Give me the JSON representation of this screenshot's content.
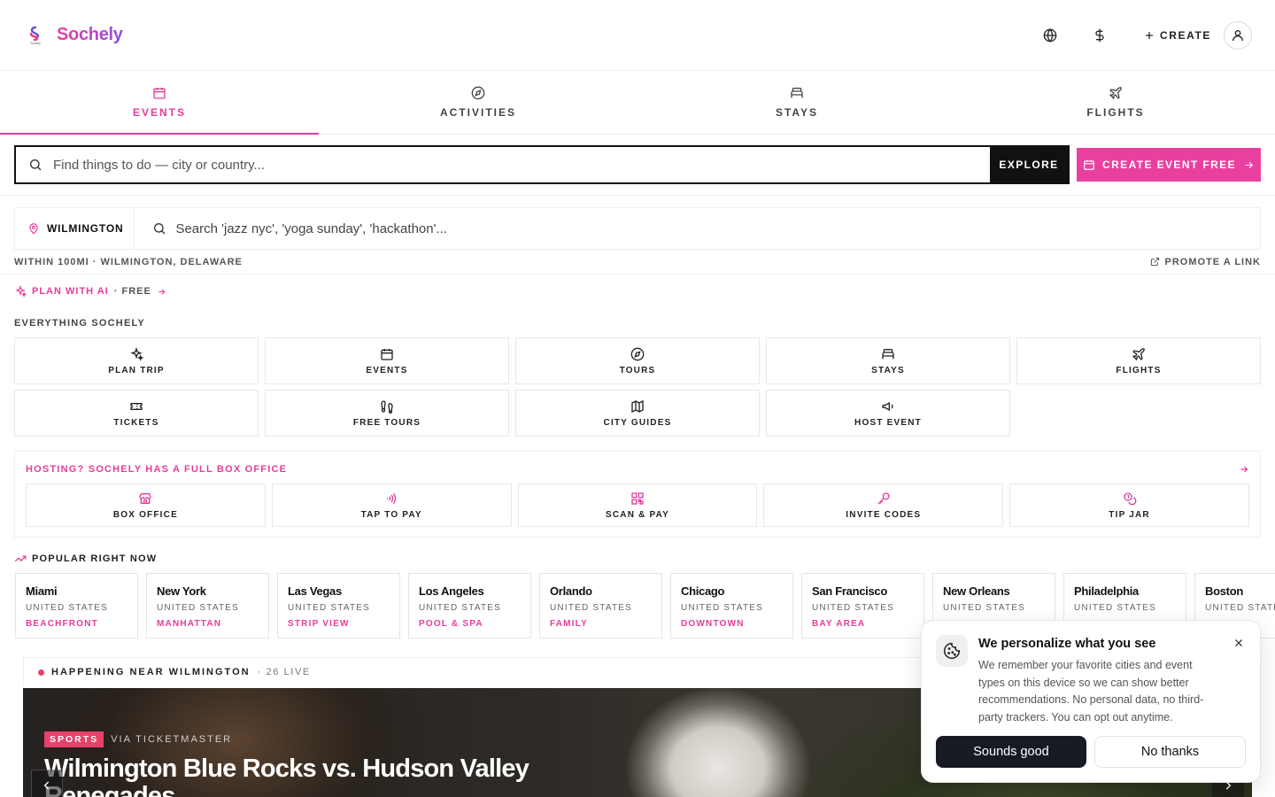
{
  "brand": {
    "name": "Sochely",
    "logo_caption": "Sochely"
  },
  "header": {
    "create_label": "CREATE"
  },
  "tabs": [
    {
      "label": "EVENTS",
      "icon": "calendar-icon",
      "active": true
    },
    {
      "label": "ACTIVITIES",
      "icon": "compass-icon",
      "active": false
    },
    {
      "label": "STAYS",
      "icon": "bed-icon",
      "active": false
    },
    {
      "label": "FLIGHTS",
      "icon": "plane-icon",
      "active": false
    }
  ],
  "search": {
    "placeholder": "Find things to do — city or country...",
    "explore_label": "EXPLORE",
    "create_event_label": "CREATE EVENT FREE"
  },
  "city_bar": {
    "city": "WILMINGTON",
    "placeholder": "Search 'jazz nyc', 'yoga sunday', 'hackathon'...",
    "radius_text": "WITHIN 100MI · WILMINGTON, DELAWARE",
    "promote_label": "PROMOTE A LINK"
  },
  "ai": {
    "label": "PLAN WITH AI",
    "free": "· FREE"
  },
  "everything": {
    "heading": "EVERYTHING SOCHELY",
    "items": [
      {
        "label": "PLAN TRIP",
        "icon": "sparkle-icon"
      },
      {
        "label": "EVENTS",
        "icon": "calendar-icon"
      },
      {
        "label": "TOURS",
        "icon": "compass-icon"
      },
      {
        "label": "STAYS",
        "icon": "bed-icon"
      },
      {
        "label": "FLIGHTS",
        "icon": "plane-icon"
      },
      {
        "label": "TICKETS",
        "icon": "ticket-icon"
      },
      {
        "label": "FREE TOURS",
        "icon": "footprints-icon"
      },
      {
        "label": "CITY GUIDES",
        "icon": "map-icon"
      },
      {
        "label": "HOST EVENT",
        "icon": "megaphone-icon"
      }
    ]
  },
  "hosting": {
    "heading": "HOSTING? SOCHELY HAS A FULL BOX OFFICE",
    "items": [
      {
        "label": "BOX OFFICE",
        "icon": "store-icon"
      },
      {
        "label": "TAP TO PAY",
        "icon": "contactless-icon"
      },
      {
        "label": "SCAN & PAY",
        "icon": "qr-code-icon"
      },
      {
        "label": "INVITE CODES",
        "icon": "key-icon"
      },
      {
        "label": "TIP JAR",
        "icon": "coins-icon"
      }
    ]
  },
  "popular": {
    "heading": "POPULAR RIGHT NOW",
    "cities": [
      {
        "name": "Miami",
        "country": "UNITED STATES",
        "tag": "BEACHFRONT"
      },
      {
        "name": "New York",
        "country": "UNITED STATES",
        "tag": "MANHATTAN"
      },
      {
        "name": "Las Vegas",
        "country": "UNITED STATES",
        "tag": "STRIP VIEW"
      },
      {
        "name": "Los Angeles",
        "country": "UNITED STATES",
        "tag": "POOL & SPA"
      },
      {
        "name": "Orlando",
        "country": "UNITED STATES",
        "tag": "FAMILY"
      },
      {
        "name": "Chicago",
        "country": "UNITED STATES",
        "tag": "DOWNTOWN"
      },
      {
        "name": "San Francisco",
        "country": "UNITED STATES",
        "tag": "BAY AREA"
      },
      {
        "name": "New Orleans",
        "country": "UNITED STATES",
        "tag": ""
      },
      {
        "name": "Philadelphia",
        "country": "UNITED STATES",
        "tag": ""
      },
      {
        "name": "Boston",
        "country": "UNITED STATES",
        "tag": ""
      }
    ]
  },
  "happening": {
    "label": "HAPPENING NEAR WILMINGTON",
    "live": "· 26 LIVE",
    "hero": {
      "category": "SPORTS",
      "source": "VIA TICKETMASTER",
      "title": "Wilmington Blue Rocks vs. Hudson Valley Renegades"
    }
  },
  "cookie": {
    "title": "We personalize what you see",
    "body": "We remember your favorite cities and event types on this device so we can show better recommendations. No personal data, no third-party trackers. You can opt out anytime.",
    "accept": "Sounds good",
    "decline": "No thanks"
  },
  "colors": {
    "accent": "#e43d9b",
    "dark": "#111111",
    "live_dot": "#e9406a"
  }
}
